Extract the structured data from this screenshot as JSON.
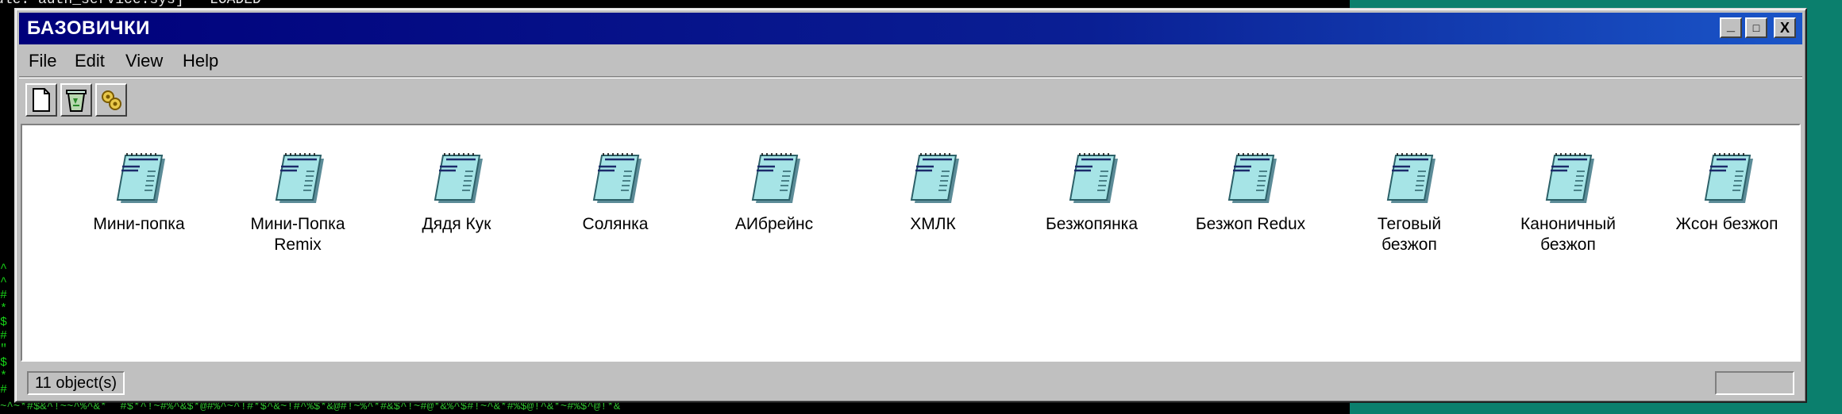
{
  "background": {
    "terminal_line": "ule: auth_service.sys] - LOADED",
    "terminal_noise": "^\n^\n#\n*\n$\n#\n\"\n$\n*\n#",
    "terminal_noise_bottom": "~^~*#$&^!~~^%^&*  #$*^!~#%^&$*@#%^~^!#*$^&~!#^%$*&@#!~%^*#&$^!~#@*&%^$#!~^&*#%$@!^&*~#%$^@!*&"
  },
  "window": {
    "title": "БАЗОВИЧКИ",
    "controls": {
      "minimize": "_",
      "maximize": "□",
      "close": "X"
    }
  },
  "menu": [
    "File",
    "Edit",
    "View",
    "Help"
  ],
  "toolbar": [
    "new-document-icon",
    "recycle-bin-icon",
    "settings-icon"
  ],
  "files": [
    {
      "label": "Мини-попка"
    },
    {
      "label": "Мини-Попка Remix"
    },
    {
      "label": "Дядя Кук"
    },
    {
      "label": "Солянка"
    },
    {
      "label": "АИбрейнс"
    },
    {
      "label": "ХМЛК"
    },
    {
      "label": "Безжопянка"
    },
    {
      "label": "Безжоп Redux"
    },
    {
      "label": "Теговый безжоп"
    },
    {
      "label": "Каноничный безжоп"
    },
    {
      "label": "Жсон безжоп"
    }
  ],
  "status": {
    "count": "11 object(s)"
  },
  "colors": {
    "titlebar": "#00007b",
    "desktop": "#0b7f6d",
    "window": "#c0c0c0",
    "icon_fill": "#9fe0e0"
  }
}
